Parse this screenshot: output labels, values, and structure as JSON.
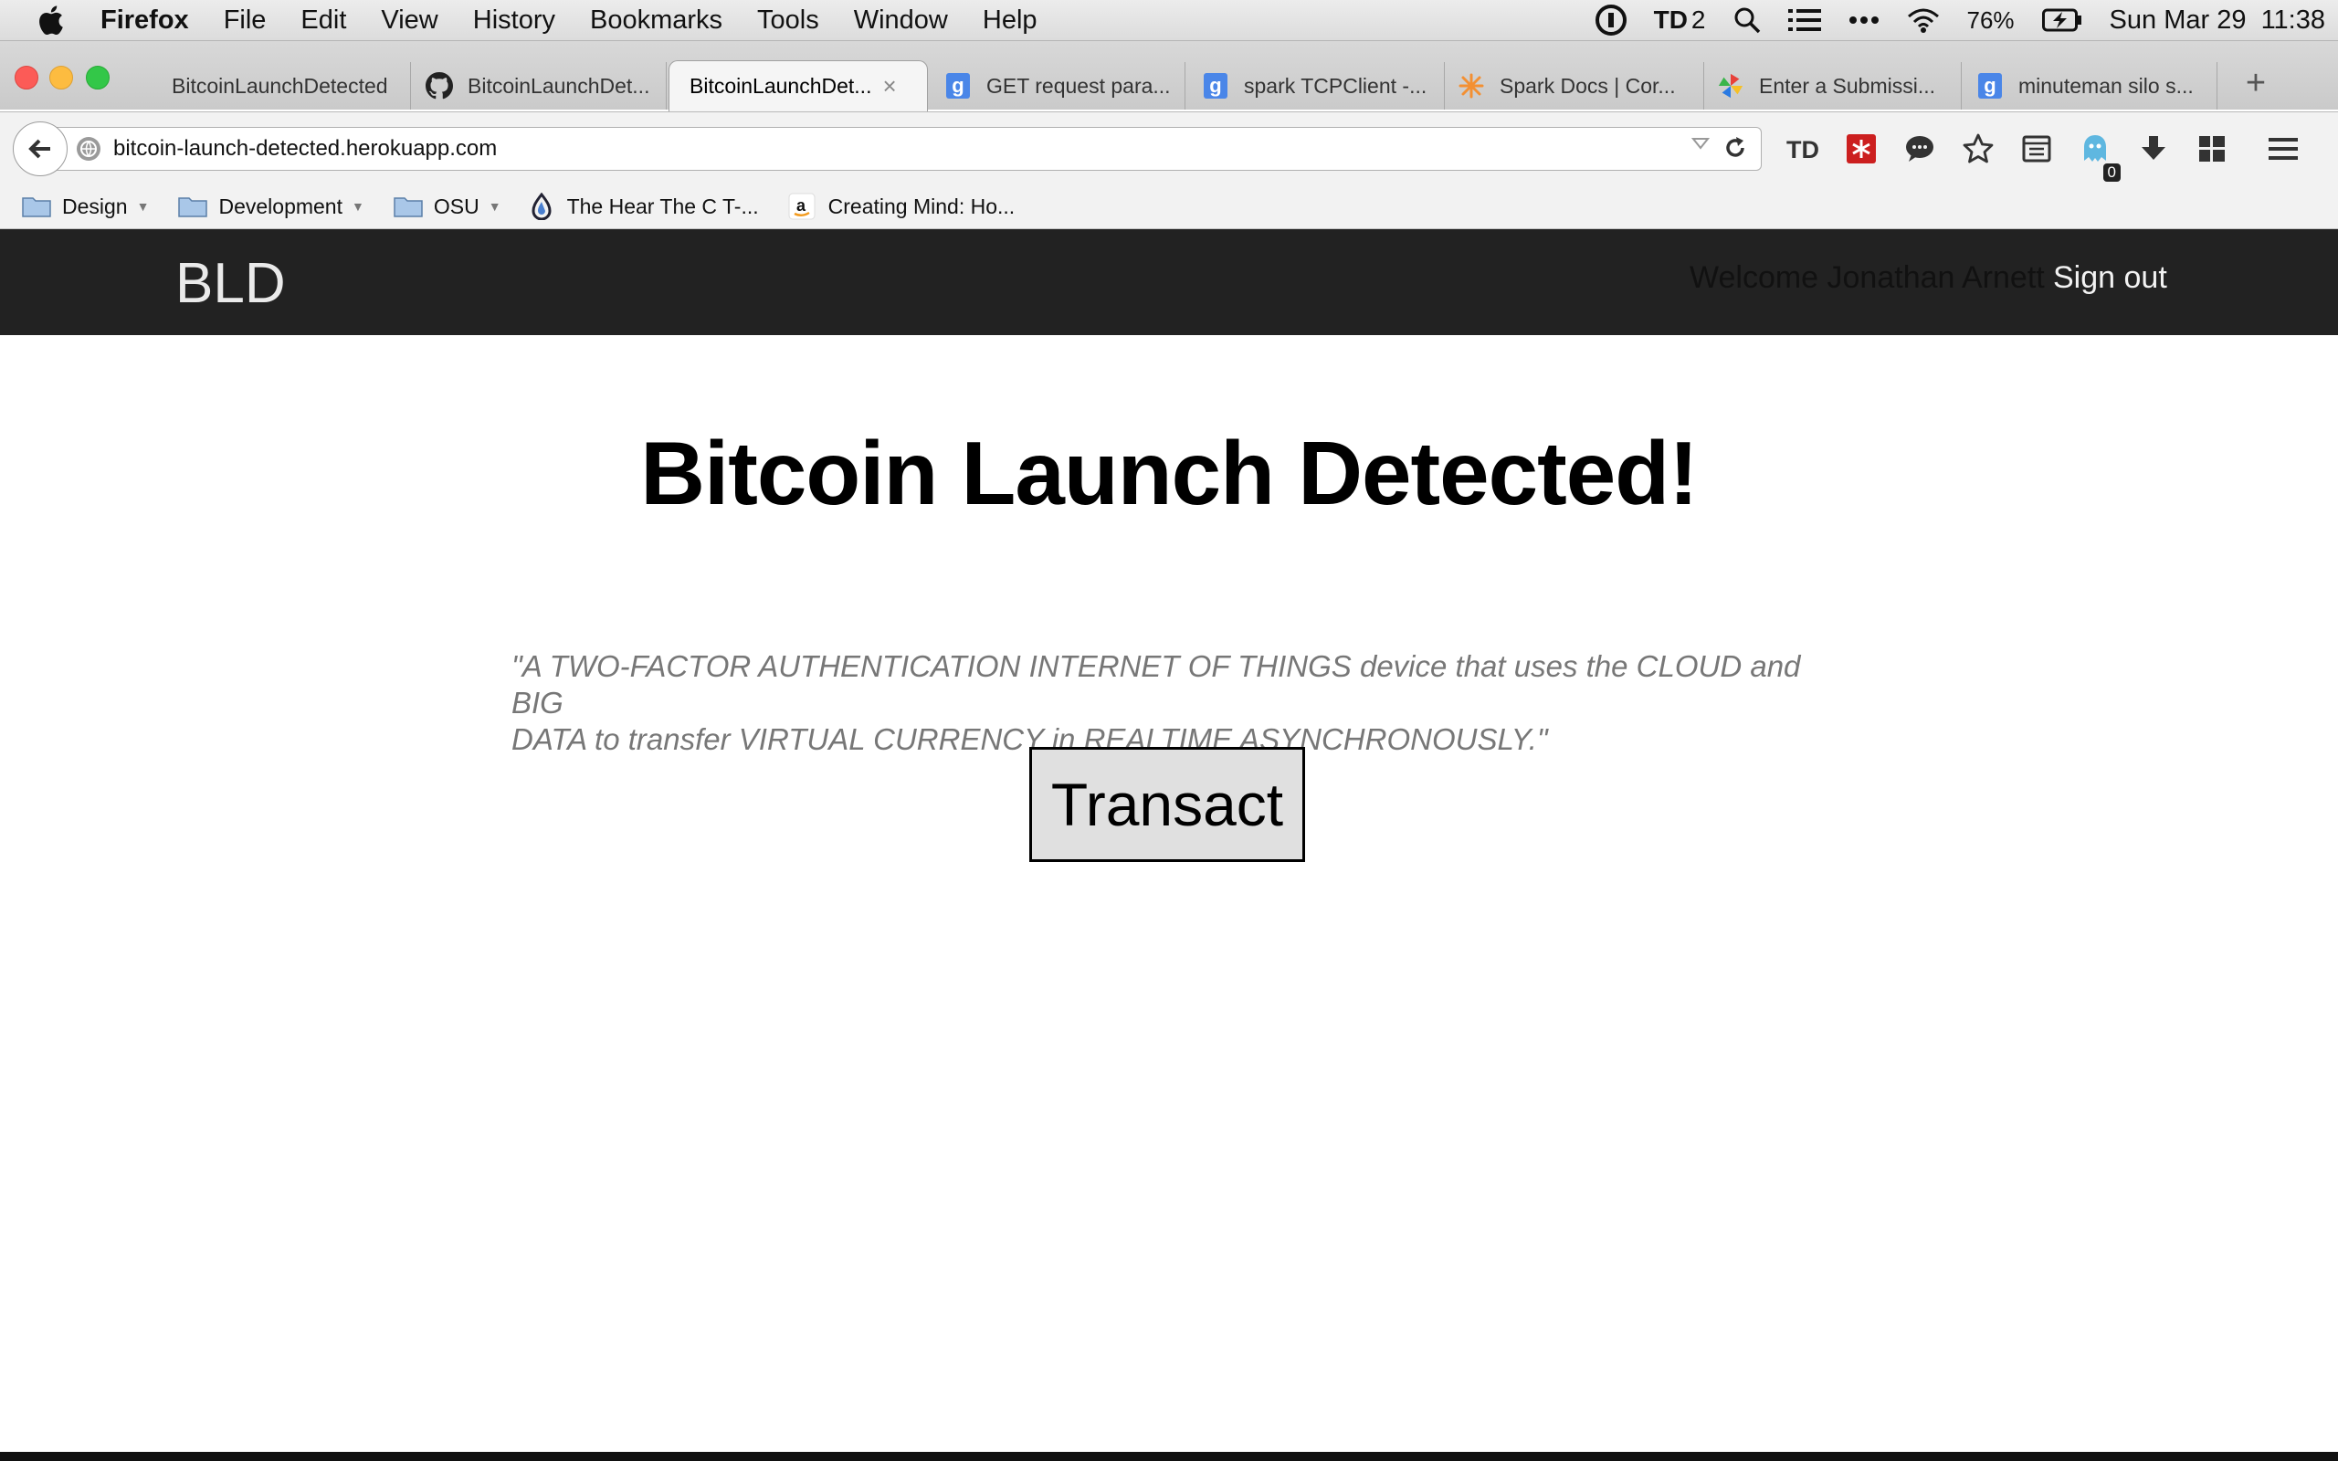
{
  "menubar": {
    "app_name": "Firefox",
    "menus": [
      "File",
      "Edit",
      "View",
      "History",
      "Bookmarks",
      "Tools",
      "Window",
      "Help"
    ],
    "td_count": "2",
    "battery": "76%",
    "datetime": "Sun Mar 29  11:38"
  },
  "tabs": [
    {
      "title": "BitcoinLaunchDetected",
      "icon": "none"
    },
    {
      "title": "BitcoinLaunchDet...",
      "icon": "github-icon"
    },
    {
      "title": "BitcoinLaunchDet...",
      "icon": "none",
      "active": true
    },
    {
      "title": "GET request para...",
      "icon": "google-icon"
    },
    {
      "title": "spark TCPClient -...",
      "icon": "google-icon"
    },
    {
      "title": "Spark Docs | Cor...",
      "icon": "spark-icon"
    },
    {
      "title": "Enter a Submissi...",
      "icon": "pinwheel-icon"
    },
    {
      "title": "minuteman silo s...",
      "icon": "google-icon"
    }
  ],
  "tab_close": "×",
  "new_tab": "+",
  "address": {
    "url": "bitcoin-launch-detected.herokuapp.com"
  },
  "toolbar": {
    "ghostery_count": "0"
  },
  "bookmarks": [
    {
      "label": "Design",
      "type": "folder"
    },
    {
      "label": "Development",
      "type": "folder"
    },
    {
      "label": "OSU",
      "type": "folder"
    },
    {
      "label": "The Hear The C T-...",
      "type": "link"
    },
    {
      "label": "Creating Mind: Ho...",
      "type": "link"
    }
  ],
  "site": {
    "brand": "BLD",
    "welcome": "Welcome Jonathan Arnett",
    "signout": "Sign out",
    "title": "Bitcoin Launch Detected!",
    "quote_line1": "\"A TWO-FACTOR AUTHENTICATION INTERNET OF THINGS device that uses the CLOUD and BIG",
    "quote_line2": "DATA to transfer VIRTUAL CURRENCY in REALTIME ASYNCHRONOUSLY.\"",
    "button": "Transact"
  },
  "colors": {
    "navbar_bg": "#222222",
    "quote_text": "#777777",
    "button_bg": "#e0e0e0"
  }
}
